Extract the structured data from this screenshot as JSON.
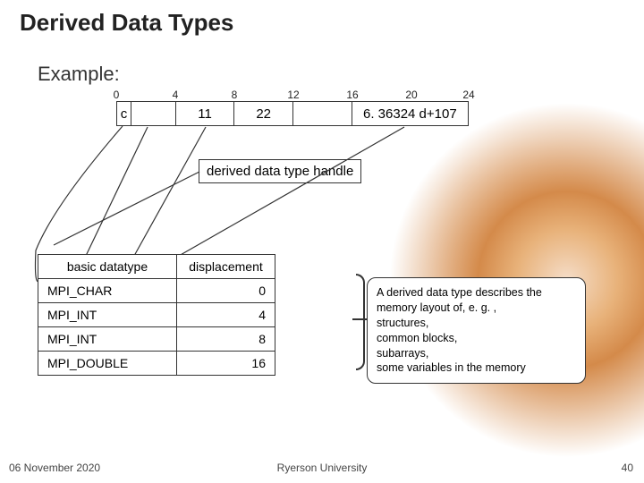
{
  "title": "Derived Data Types",
  "section": "Example:",
  "ticks": [
    "0",
    "4",
    "8",
    "12",
    "16",
    "20",
    "24"
  ],
  "mem": {
    "cells": [
      {
        "label": "c",
        "w": 16
      },
      {
        "label": "",
        "w": 50
      },
      {
        "label": "11",
        "w": 66
      },
      {
        "label": "22",
        "w": 66
      },
      {
        "label": "",
        "w": 66
      },
      {
        "label": "6. 36324 d+107",
        "w": 130
      }
    ]
  },
  "handle": "derived data type handle",
  "table": {
    "headers": [
      "basic datatype",
      "displacement"
    ],
    "rows": [
      {
        "t": "MPI_CHAR",
        "d": "0"
      },
      {
        "t": "MPI_INT",
        "d": "4"
      },
      {
        "t": "MPI_INT",
        "d": "8"
      },
      {
        "t": "MPI_DOUBLE",
        "d": "16"
      }
    ]
  },
  "desc": {
    "l1": "A derived data type describes the memory layout of, e. g. ,",
    "l2": "structures,",
    "l3": "common blocks,",
    "l4": "subarrays,",
    "l5": "some variables in the memory"
  },
  "footer": {
    "date": "06 November 2020",
    "mid": "Ryerson University",
    "num": "40"
  }
}
